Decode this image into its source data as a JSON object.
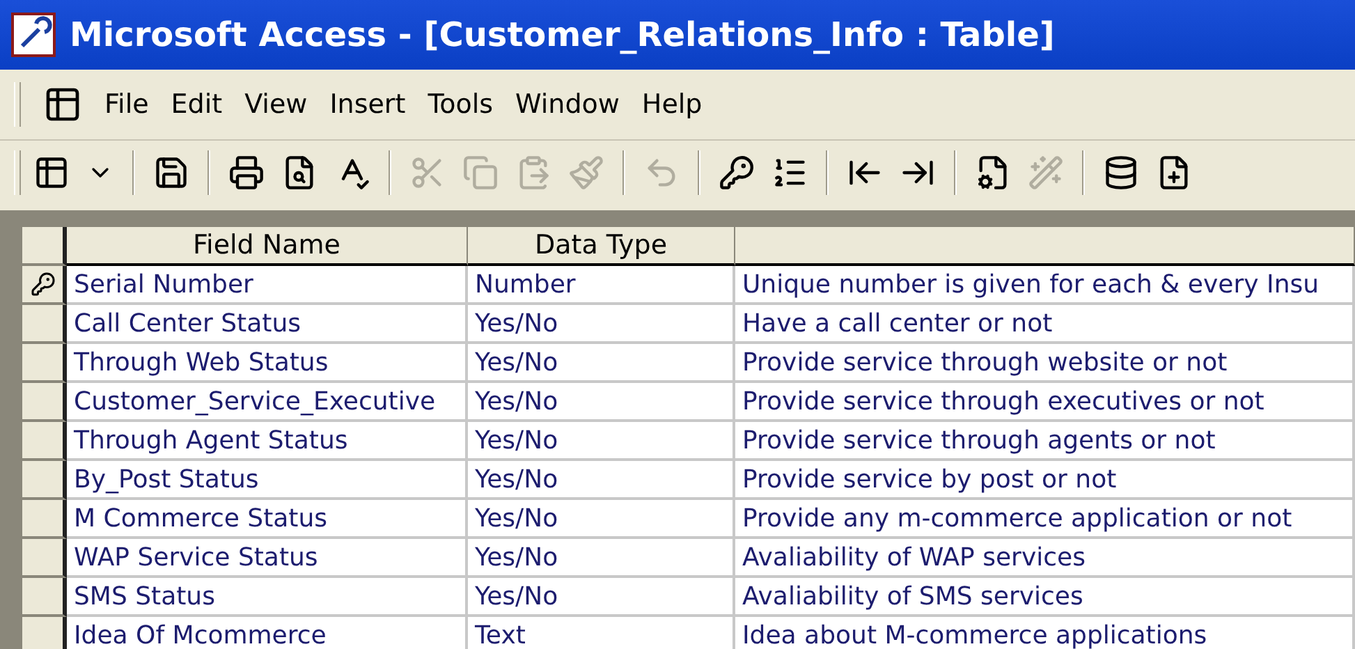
{
  "window": {
    "title": "Microsoft Access - [Customer_Relations_Info : Table]"
  },
  "menu": [
    "File",
    "Edit",
    "View",
    "Insert",
    "Tools",
    "Window",
    "Help"
  ],
  "toolbar": [
    [
      {
        "kind": "view",
        "disabled": false
      },
      {
        "kind": "dropdown",
        "disabled": false
      }
    ],
    [
      {
        "kind": "save",
        "disabled": false
      }
    ],
    [
      {
        "kind": "print",
        "disabled": false
      },
      {
        "kind": "preview",
        "disabled": false
      },
      {
        "kind": "spelling",
        "disabled": false
      }
    ],
    [
      {
        "kind": "cut",
        "disabled": true
      },
      {
        "kind": "copy",
        "disabled": true
      },
      {
        "kind": "paste",
        "disabled": true
      },
      {
        "kind": "brush",
        "disabled": true
      }
    ],
    [
      {
        "kind": "undo",
        "disabled": true
      }
    ],
    [
      {
        "kind": "key",
        "disabled": false
      },
      {
        "kind": "indexes",
        "disabled": false
      }
    ],
    [
      {
        "kind": "insert-rows",
        "disabled": false
      },
      {
        "kind": "delete-rows",
        "disabled": false
      }
    ],
    [
      {
        "kind": "properties",
        "disabled": false
      },
      {
        "kind": "build",
        "disabled": true
      }
    ],
    [
      {
        "kind": "database",
        "disabled": false
      },
      {
        "kind": "new-object",
        "disabled": false
      }
    ]
  ],
  "table": {
    "columns": [
      "Field Name",
      "Data Type"
    ],
    "rows": [
      {
        "primary_key": true,
        "field": "Serial Number",
        "type": "Number",
        "description": "Unique number is given for each & every Insu"
      },
      {
        "primary_key": false,
        "field": "Call Center Status",
        "type": "Yes/No",
        "description": "Have a call center or not"
      },
      {
        "primary_key": false,
        "field": "Through Web Status",
        "type": "Yes/No",
        "description": "Provide service through website or not"
      },
      {
        "primary_key": false,
        "field": "Customer_Service_Executive",
        "type": "Yes/No",
        "description": "Provide service through executives or not"
      },
      {
        "primary_key": false,
        "field": "Through Agent Status",
        "type": "Yes/No",
        "description": "Provide service through agents or not"
      },
      {
        "primary_key": false,
        "field": "By_Post Status",
        "type": "Yes/No",
        "description": "Provide service by post or not"
      },
      {
        "primary_key": false,
        "field": "M Commerce Status",
        "type": "Yes/No",
        "description": "Provide any m-commerce application or not"
      },
      {
        "primary_key": false,
        "field": "WAP Service Status",
        "type": "Yes/No",
        "description": "Avaliability of WAP services"
      },
      {
        "primary_key": false,
        "field": "SMS Status",
        "type": "Yes/No",
        "description": "Avaliability of SMS services"
      },
      {
        "primary_key": false,
        "field": "Idea Of Mcommerce",
        "type": "Text",
        "description": "Idea about M-commerce applications"
      }
    ]
  }
}
